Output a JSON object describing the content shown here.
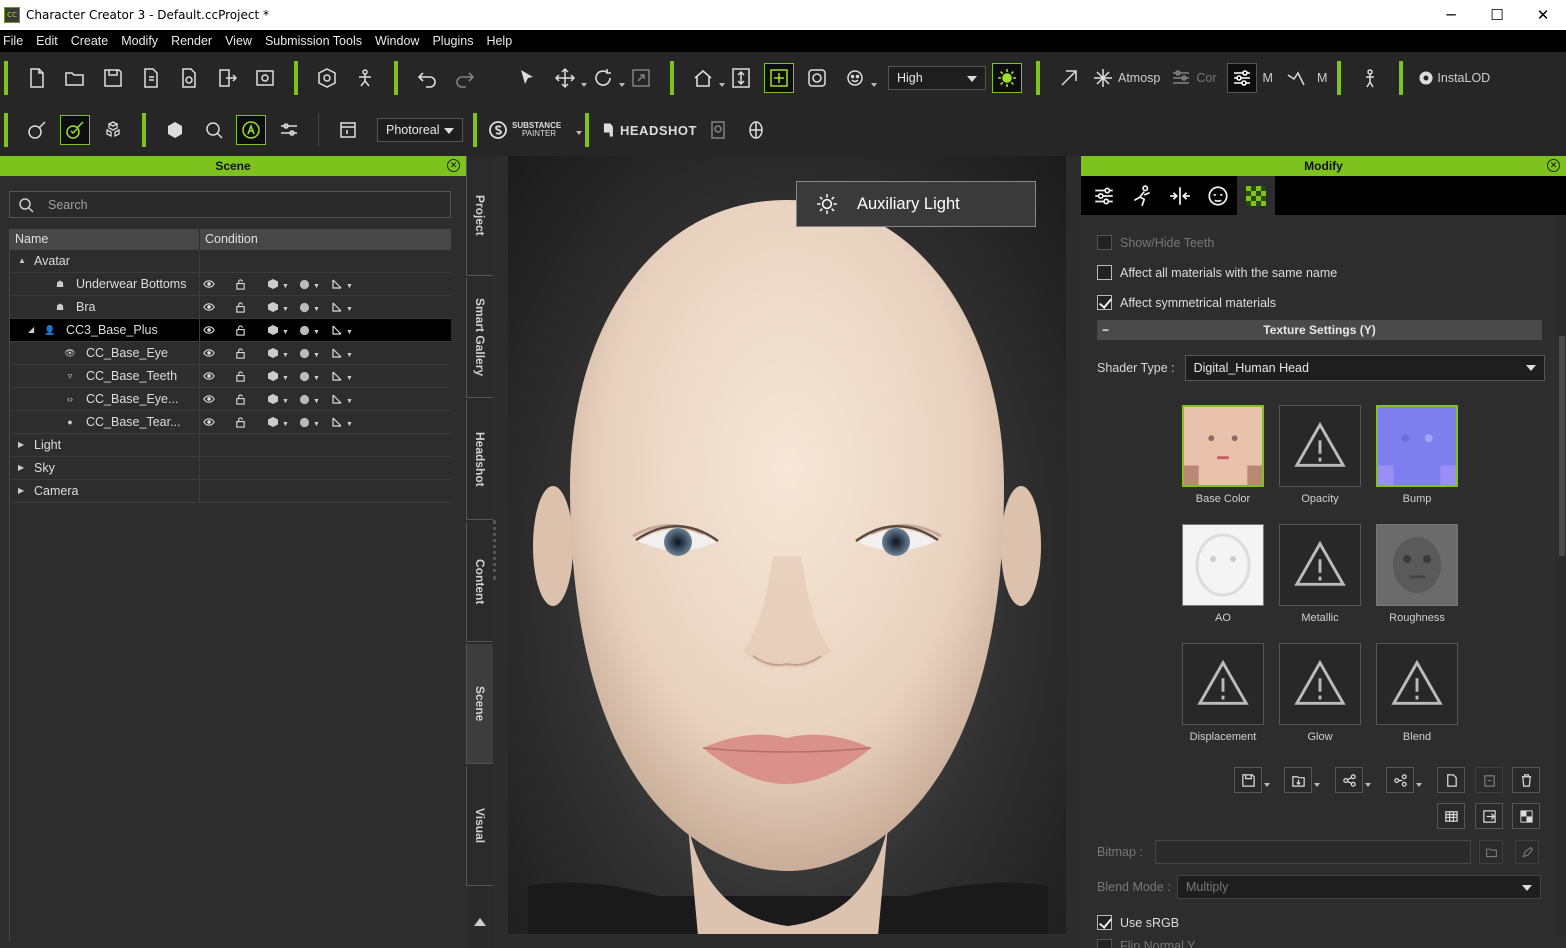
{
  "window": {
    "title": "Character Creator 3 - Default.ccProject *",
    "app_icon": "CC",
    "minimize": "─",
    "maximize": "☐",
    "close": "✕"
  },
  "menu": [
    "File",
    "Edit",
    "Create",
    "Modify",
    "Render",
    "View",
    "Submission Tools",
    "Window",
    "Plugins",
    "Help"
  ],
  "toolbar1": {
    "quality": "High",
    "atmosphere_label": "Atmosp",
    "cor_label": "Cor",
    "m_label1": "M",
    "m_label2": "M",
    "instalod_label": "InstaLOD"
  },
  "toolbar2": {
    "render_mode": "Photoreal",
    "substance_top": "SUBSTANCE",
    "substance_bottom": "PAINTER",
    "headshot_label": "HEADSHOT"
  },
  "scene": {
    "title": "Scene",
    "search_placeholder": "Search",
    "col_name": "Name",
    "col_condition": "Condition",
    "rows": [
      {
        "label": "Avatar",
        "indent": 0,
        "arrow": "▲",
        "icon": ""
      },
      {
        "label": "Underwear Bottoms",
        "indent": 2,
        "arrow": "",
        "icon": "☗",
        "cond": true
      },
      {
        "label": "Bra",
        "indent": 2,
        "arrow": "",
        "icon": "☗",
        "cond": true
      },
      {
        "label": "CC3_Base_Plus",
        "indent": 1,
        "arrow": "◢",
        "icon": "👤",
        "cond": true,
        "selected": true
      },
      {
        "label": "CC_Base_Eye",
        "indent": 3,
        "arrow": "",
        "icon": "👁",
        "cond": true
      },
      {
        "label": "CC_Base_Teeth",
        "indent": 3,
        "arrow": "",
        "icon": "▿",
        "cond": true
      },
      {
        "label": "CC_Base_Eye...",
        "indent": 3,
        "arrow": "",
        "icon": "‹›",
        "cond": true
      },
      {
        "label": "CC_Base_Tear...",
        "indent": 3,
        "arrow": "",
        "icon": "●",
        "cond": true
      },
      {
        "label": "Light",
        "indent": 0,
        "arrow": "▶",
        "icon": ""
      },
      {
        "label": "Sky",
        "indent": 0,
        "arrow": "▶",
        "icon": ""
      },
      {
        "label": "Camera",
        "indent": 0,
        "arrow": "▶",
        "icon": ""
      }
    ]
  },
  "side_tabs": [
    "Project",
    "Smart Gallery",
    "Headshot",
    "Content",
    "Scene",
    "Visual"
  ],
  "viewport": {
    "aux_light": "Auxiliary Light"
  },
  "modify": {
    "title": "Modify",
    "show_hide_teeth": "Show/Hide Teeth",
    "affect_same_name": "Affect all materials with the same name",
    "affect_symmetrical": "Affect symmetrical materials",
    "texture_settings": "Texture Settings  (Y)",
    "texture_minus": "−",
    "shader_label": "Shader Type :",
    "shader_value": "Digital_Human Head",
    "textures": [
      "Base Color",
      "Opacity",
      "Bump",
      "AO",
      "Metallic",
      "Roughness",
      "Displacement",
      "Glow",
      "Blend"
    ],
    "bitmap_label": "Bitmap :",
    "blend_mode_label": "Blend Mode :",
    "blend_mode_value": "Multiply",
    "use_srgb": "Use sRGB",
    "flip_normal": "Flip Normal Y"
  },
  "colors": {
    "accent": "#7ec21e",
    "panel": "#2d2d2d",
    "toolbar": "#262626"
  }
}
